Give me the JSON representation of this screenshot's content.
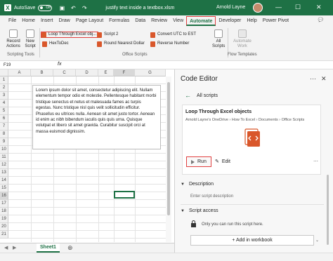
{
  "titlebar": {
    "autosave_label": "AutoSave",
    "autosave_state": "Off",
    "doc_title": "justify text inside a textbox.xlsm",
    "user_name": "Arnold Layne",
    "min": "—",
    "max": "☐",
    "close": "✕"
  },
  "tabs": [
    "File",
    "Home",
    "Insert",
    "Draw",
    "Page Layout",
    "Formulas",
    "Data",
    "Review",
    "View",
    "Automate",
    "Developer",
    "Help",
    "Power Pivot"
  ],
  "ribbon": {
    "record_actions": "Record Actions",
    "new_script": "New Script",
    "scripting_tools": "Scripting Tools",
    "scripts": [
      "Loop Through Excel obj...",
      "HexToDec",
      "Script 2",
      "Round Nearest Dollar",
      "Convert UTC to EST",
      "Reverse Number"
    ],
    "office_scripts": "Office Scripts",
    "all_scripts": "All Scripts",
    "automate_work": "Automate Work",
    "flow_templates": "Flow Templates"
  },
  "formula_bar": {
    "name_box": "F19",
    "fx": "fx"
  },
  "grid": {
    "columns": [
      "A",
      "B",
      "C",
      "D",
      "E",
      "F",
      "G"
    ],
    "rows": [
      "1",
      "2",
      "3",
      "4",
      "5",
      "6",
      "7",
      "8",
      "9",
      "10",
      "11",
      "12",
      "13",
      "14",
      "15",
      "16",
      "17",
      "18",
      "19",
      "20",
      "21"
    ],
    "textbox_text": "Lorem ipsum dolor sit amet, consectetur adipiscing elit. Nullam elementum tempor odio et molestie. Pellentesque habitant morbi tristique senectus et netus et malesuada fames ac turpis egestas. Nunc tristique nisl quis velit sollicitudin efficitur. Phasellus eu ultrices nulla. Aenean sit amet justo tortor. Aenean id enim ac nibh bibendum iaculis quis quis urna. Quisque volutpat et libero sit amet gravida. Curabitur suscipit orci at massa euismod dignissim."
  },
  "sheet": {
    "tab": "Sheet1"
  },
  "pane": {
    "title": "Code Editor",
    "back_label": "All scripts",
    "script_title": "Loop Through Excel objects",
    "script_path": "Arnold Layne's OneDrive › How To Excel › Documents › Office Scripts",
    "run": "Run",
    "edit": "Edit",
    "description_hdr": "Description",
    "description_placeholder": "Enter script description",
    "access_hdr": "Script access",
    "access_text": "Only you can run this script here.",
    "add_in_workbook": "Add in workbook"
  },
  "colors": {
    "excel_green": "#1e7145",
    "highlight_red": "#e04040",
    "script_orange": "#d9572b"
  }
}
